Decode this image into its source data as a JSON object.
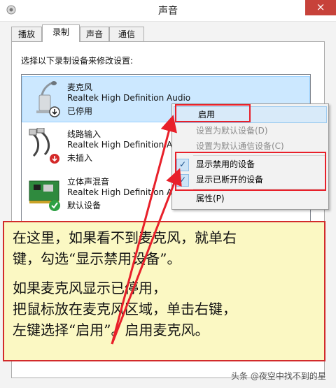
{
  "window": {
    "title": "声音",
    "close_glyph": "×"
  },
  "tabs": [
    {
      "label": "播放"
    },
    {
      "label": "录制"
    },
    {
      "label": "声音"
    },
    {
      "label": "通信"
    }
  ],
  "instruction": "选择以下录制设备来修改设置:",
  "devices": [
    {
      "name": "麦克风",
      "driver": "Realtek High Definition Audio",
      "status": "已停用",
      "icon": "microphone-icon"
    },
    {
      "name": "线路输入",
      "driver": "Realtek High Definition Au",
      "status": "未插入",
      "icon": "line-in-cable-icon"
    },
    {
      "name": "立体声混音",
      "driver": "Realtek High Definition Au",
      "status": "默认设备",
      "icon": "sound-card-icon"
    }
  ],
  "context_menu": {
    "enable": "启用",
    "set_default": "设置为默认设备(D)",
    "set_default_comm": "设置为默认通信设备(C)",
    "show_disabled": "显示禁用的设备",
    "show_disconnected": "显示已断开的设备",
    "properties": "属性(P)",
    "check_glyph": "✓"
  },
  "callout": {
    "line1": "在这里，如果看不到麦克风，就单右",
    "line2": "键，勾选“显示禁用设备”。",
    "line3": "如果麦克风显示已停用，",
    "line4": "把鼠标放在麦克风区域，单击右键，",
    "line5": "左键选择“启用”。启用麦克风。"
  },
  "watermark": "头条 @夜空中找不到的星",
  "colors": {
    "annotation_red": "#e8202a",
    "callout_bg": "#fbf8c3",
    "selection": "#cce8ff"
  }
}
